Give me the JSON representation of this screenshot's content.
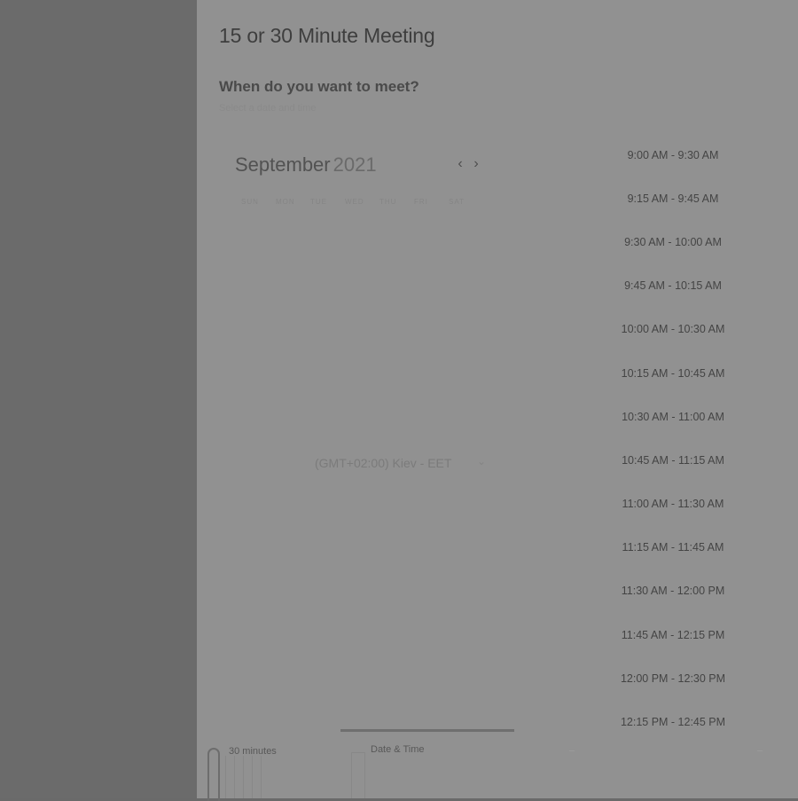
{
  "meeting": {
    "title": "15 or 30 Minute Meeting",
    "question": "When do you want to meet?",
    "hint": "Select a date and time"
  },
  "calendar": {
    "month": "September",
    "year": "2021",
    "weekdays": [
      "SUN",
      "MON",
      "TUE",
      "WED",
      "THU",
      "FRI",
      "SAT"
    ]
  },
  "timezone": {
    "value": "(GMT+02:00) Kiev - EET"
  },
  "time_slots": [
    "9:00 AM - 9:30 AM",
    "9:15 AM - 9:45 AM",
    "9:30 AM - 10:00 AM",
    "9:45 AM - 10:15 AM",
    "10:00 AM - 10:30 AM",
    "10:15 AM - 10:45 AM",
    "10:30 AM - 11:00 AM",
    "10:45 AM - 11:15 AM",
    "11:00 AM - 11:30 AM",
    "11:15 AM - 11:45 AM",
    "11:30 AM - 12:00 PM",
    "11:45 AM - 12:15 PM",
    "12:00 PM - 12:30 PM",
    "12:15 PM - 12:45 PM"
  ],
  "steps": {
    "duration": "30 minutes",
    "datetime": "Date & Time"
  },
  "icons": {
    "prev": "chevron-left-icon",
    "next": "chevron-right-icon",
    "timezone_dropdown": "chevron-down-icon"
  }
}
